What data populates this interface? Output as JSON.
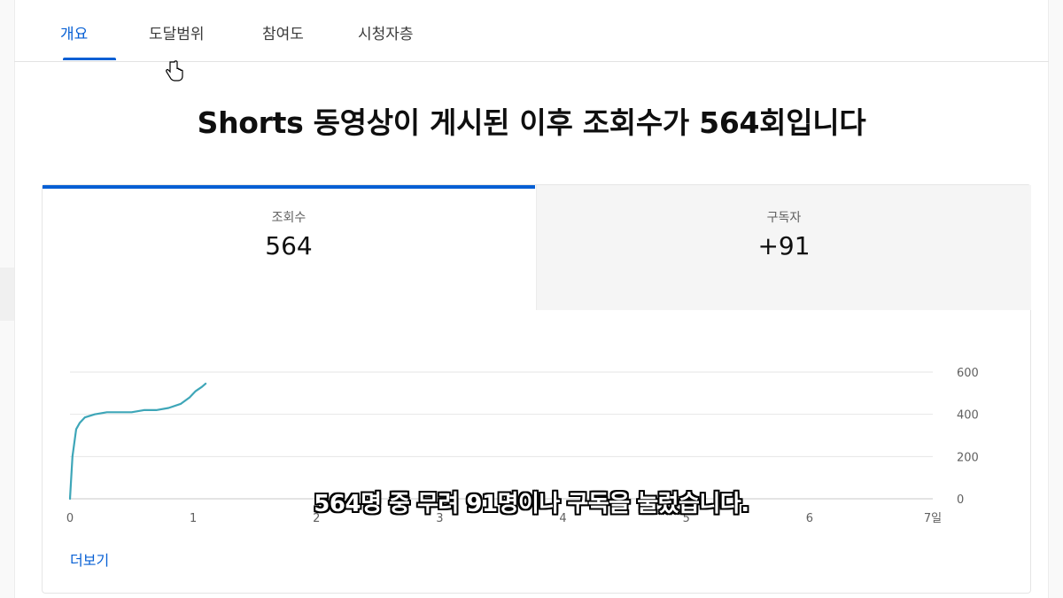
{
  "tabs": [
    {
      "label": "개요",
      "active": true
    },
    {
      "label": "도달범위",
      "active": false
    },
    {
      "label": "참여도",
      "active": false
    },
    {
      "label": "시청자층",
      "active": false
    }
  ],
  "headline": "Shorts 동영상이 게시된 이후 조회수가 564회입니다",
  "metrics": [
    {
      "label": "조회수",
      "value": "564"
    },
    {
      "label": "구독자",
      "value": "+91"
    }
  ],
  "more_link": "더보기",
  "subtitle": "564명 중 무려 91명이나 구독을 눌렀습니다.",
  "colors": {
    "accent": "#065fd4",
    "line": "#3ea6b8"
  },
  "chart_data": {
    "type": "line",
    "x_ticks": [
      "0",
      "1",
      "2",
      "3",
      "4",
      "5",
      "6",
      "7일"
    ],
    "y_ticks": [
      "0",
      "200",
      "400",
      "600"
    ],
    "xlim": [
      0,
      7
    ],
    "ylim": [
      0,
      600
    ],
    "series": [
      {
        "x": [
          0,
          0.02,
          0.05,
          0.08,
          0.12,
          0.2,
          0.3,
          0.4,
          0.5,
          0.6,
          0.7,
          0.8,
          0.9,
          0.97,
          1.02,
          1.07,
          1.1
        ],
        "y": [
          0,
          200,
          330,
          360,
          385,
          400,
          410,
          410,
          410,
          420,
          420,
          430,
          450,
          480,
          510,
          530,
          545
        ]
      }
    ]
  }
}
